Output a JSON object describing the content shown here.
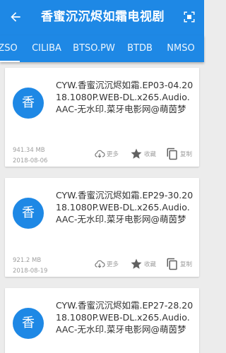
{
  "appbar": {
    "title": "香蜜沉沉烬如霜电视剧",
    "back_icon": "arrow-left-icon",
    "menu_icon": "qr-scan-icon",
    "background": "#1e88e5"
  },
  "tabs": [
    {
      "label": "ZSO",
      "active": true
    },
    {
      "label": "CILIBA"
    },
    {
      "label": "BTSO.PW"
    },
    {
      "label": "BTDB"
    },
    {
      "label": "NMSO"
    }
  ],
  "results": [
    {
      "avatar": "香",
      "title": "CYW.香蜜沉沉烬如霜.EP03-04.2018.1080P.WEB-DL.x265.Audio.AAC-无水印.菜牙电影网@萌茵梦",
      "size": "941.34 MB",
      "date": "2018-08-06",
      "more_label": "更多",
      "fav_label": "收藏",
      "copy_label": "复制"
    },
    {
      "avatar": "香",
      "title": "CYW.香蜜沉沉烬如霜.EP29-30.2018.1080P.WEB-DL.x265.Audio.AAC-无水印.菜牙电影网@萌茵梦",
      "size": "921.2 MB",
      "date": "2018-08-19",
      "more_label": "更多",
      "fav_label": "收藏",
      "copy_label": "复制"
    },
    {
      "avatar": "香",
      "title": "CYW.香蜜沉沉烬如霜.EP27-28.2018.1080P.WEB-DL.x265.Audio.AAC-无水印.菜牙电影网@萌茵梦"
    }
  ],
  "colors": {
    "primary": "#1e88e5",
    "muted": "#9e9e9e",
    "icon": "#616161"
  }
}
